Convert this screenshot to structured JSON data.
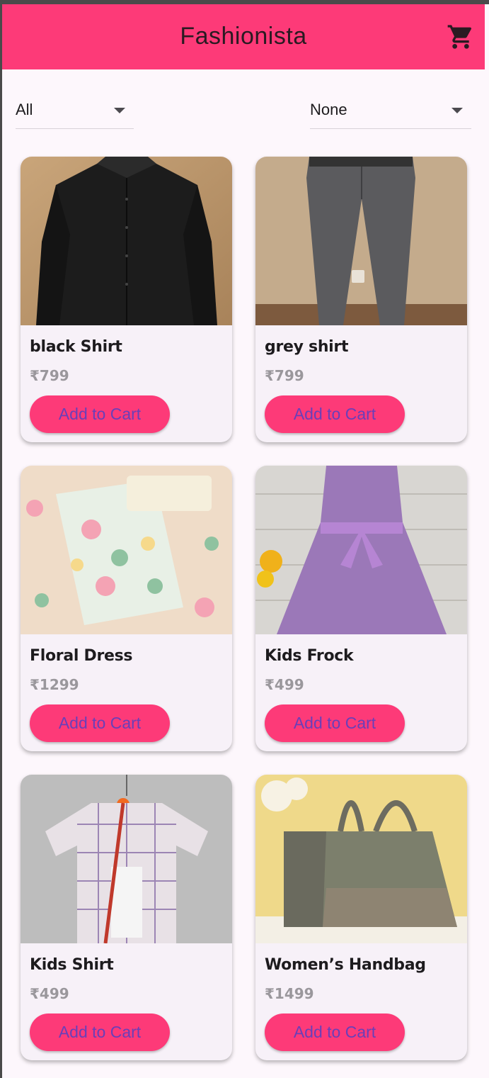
{
  "app": {
    "title": "Fashionista",
    "cart_icon": "shopping-cart-icon"
  },
  "filters": {
    "category": {
      "selected": "All"
    },
    "sort": {
      "selected": "None"
    }
  },
  "colors": {
    "accent": "#fd3a78",
    "button_text": "#6a3fb8",
    "background": "#fdf7fc"
  },
  "products": [
    {
      "name": "black Shirt",
      "price": "₹799",
      "button": "Add to Cart"
    },
    {
      "name": "grey shirt",
      "price": "₹799",
      "button": "Add to Cart"
    },
    {
      "name": "Floral Dress",
      "price": "₹1299",
      "button": "Add to Cart"
    },
    {
      "name": "Kids Frock",
      "price": "₹499",
      "button": "Add to Cart"
    },
    {
      "name": "Kids Shirt",
      "price": "₹499",
      "button": "Add to Cart"
    },
    {
      "name": "Women’s Handbag",
      "price": "₹1499",
      "button": "Add to Cart"
    }
  ]
}
